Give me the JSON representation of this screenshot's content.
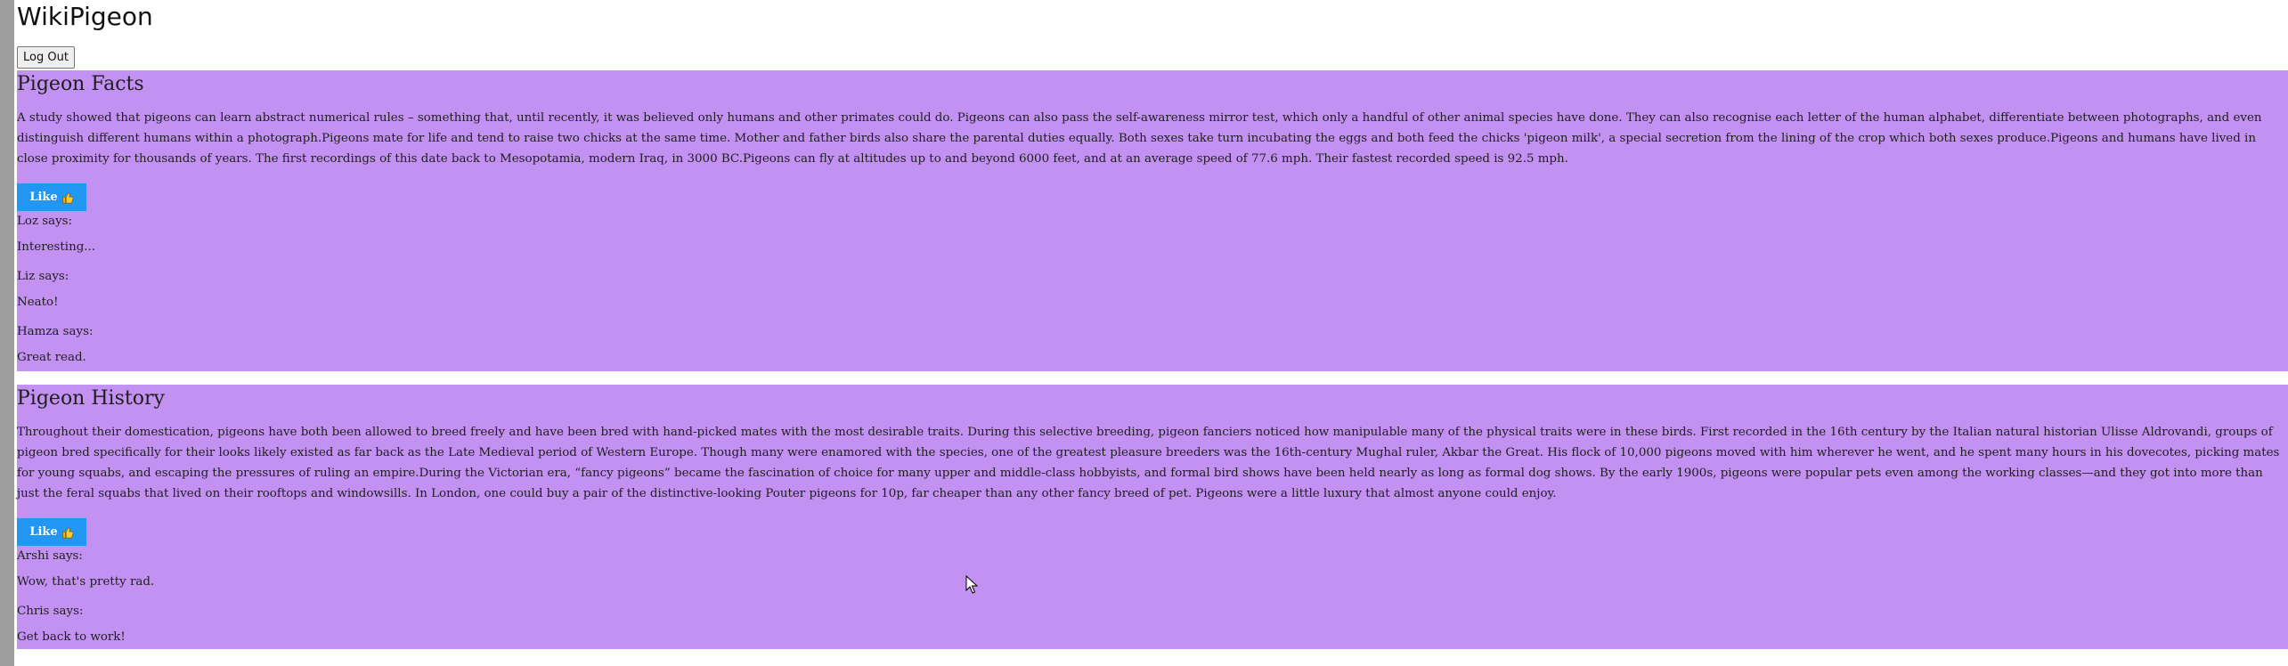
{
  "app": {
    "title": "WikiPigeon"
  },
  "header": {
    "logout_label": "Log Out"
  },
  "sections": [
    {
      "title": "Pigeon Facts",
      "body": "A study showed that pigeons can learn abstract numerical rules – something that, until recently, it was believed only humans and other primates could do. Pigeons can also pass the self-awareness mirror test, which only a handful of other animal species have done. They can also recognise each letter of the human alphabet, differentiate between photographs, and even distinguish different humans within a photograph.Pigeons mate for life and tend to raise two chicks at the same time. Mother and father birds also share the parental duties equally. Both sexes take turn incubating the eggs and both feed the chicks 'pigeon milk', a special secretion from the lining of the crop which both sexes produce.Pigeons and humans have lived in close proximity for thousands of years. The first recordings of this date back to Mesopotamia, modern Iraq, in 3000 BC.Pigeons can fly at altitudes up to and beyond 6000 feet, and at an average speed of 77.6 mph. Their fastest recorded speed is 92.5 mph.",
      "like_label": "Like",
      "comments": [
        {
          "author": "Loz says:",
          "text": "Interesting..."
        },
        {
          "author": "Liz says:",
          "text": "Neato!"
        },
        {
          "author": "Hamza says:",
          "text": "Great read."
        }
      ]
    },
    {
      "title": "Pigeon History",
      "body": "Throughout their domestication, pigeons have both been allowed to breed freely and have been bred with hand-picked mates with the most desirable traits. During this selective breeding, pigeon fanciers noticed how manipulable many of the physical traits were in these birds. First recorded in the 16th century by the Italian natural historian Ulisse Aldrovandi, groups of pigeon bred specifically for their looks likely existed as far back as the Late Medieval period of Western Europe. Though many were enamored with the species, one of the greatest pleasure breeders was the 16th-century Mughal ruler, Akbar the Great. His flock of 10,000 pigeons moved with him wherever he went, and he spent many hours in his dovecotes, picking mates for young squabs, and escaping the pressures of ruling an empire.During the Victorian era, “fancy pigeons” became the fascination of choice for many upper and middle-class hobbyists, and formal bird shows have been held nearly as long as formal dog shows. By the early 1900s, pigeons were popular pets even among the working classes—and they got into more than just the feral squabs that lived on their rooftops and windowsills. In London, one could buy a pair of the distinctive-looking Pouter pigeons for 10p, far cheaper than any other fancy breed of pet. Pigeons were a little luxury that almost anyone could enjoy.",
      "like_label": "Like",
      "comments": [
        {
          "author": "Arshi says:",
          "text": "Wow, that's pretty rad."
        },
        {
          "author": "Chris says:",
          "text": "Get back to work!"
        }
      ]
    }
  ],
  "colors": {
    "section_bg": "#c391f2",
    "like_button_bg": "#2196f3",
    "scrollbar": "#9e9e9e"
  },
  "icons": {
    "like": "thumbs-up-icon",
    "cursor": "mouse-pointer-icon"
  }
}
